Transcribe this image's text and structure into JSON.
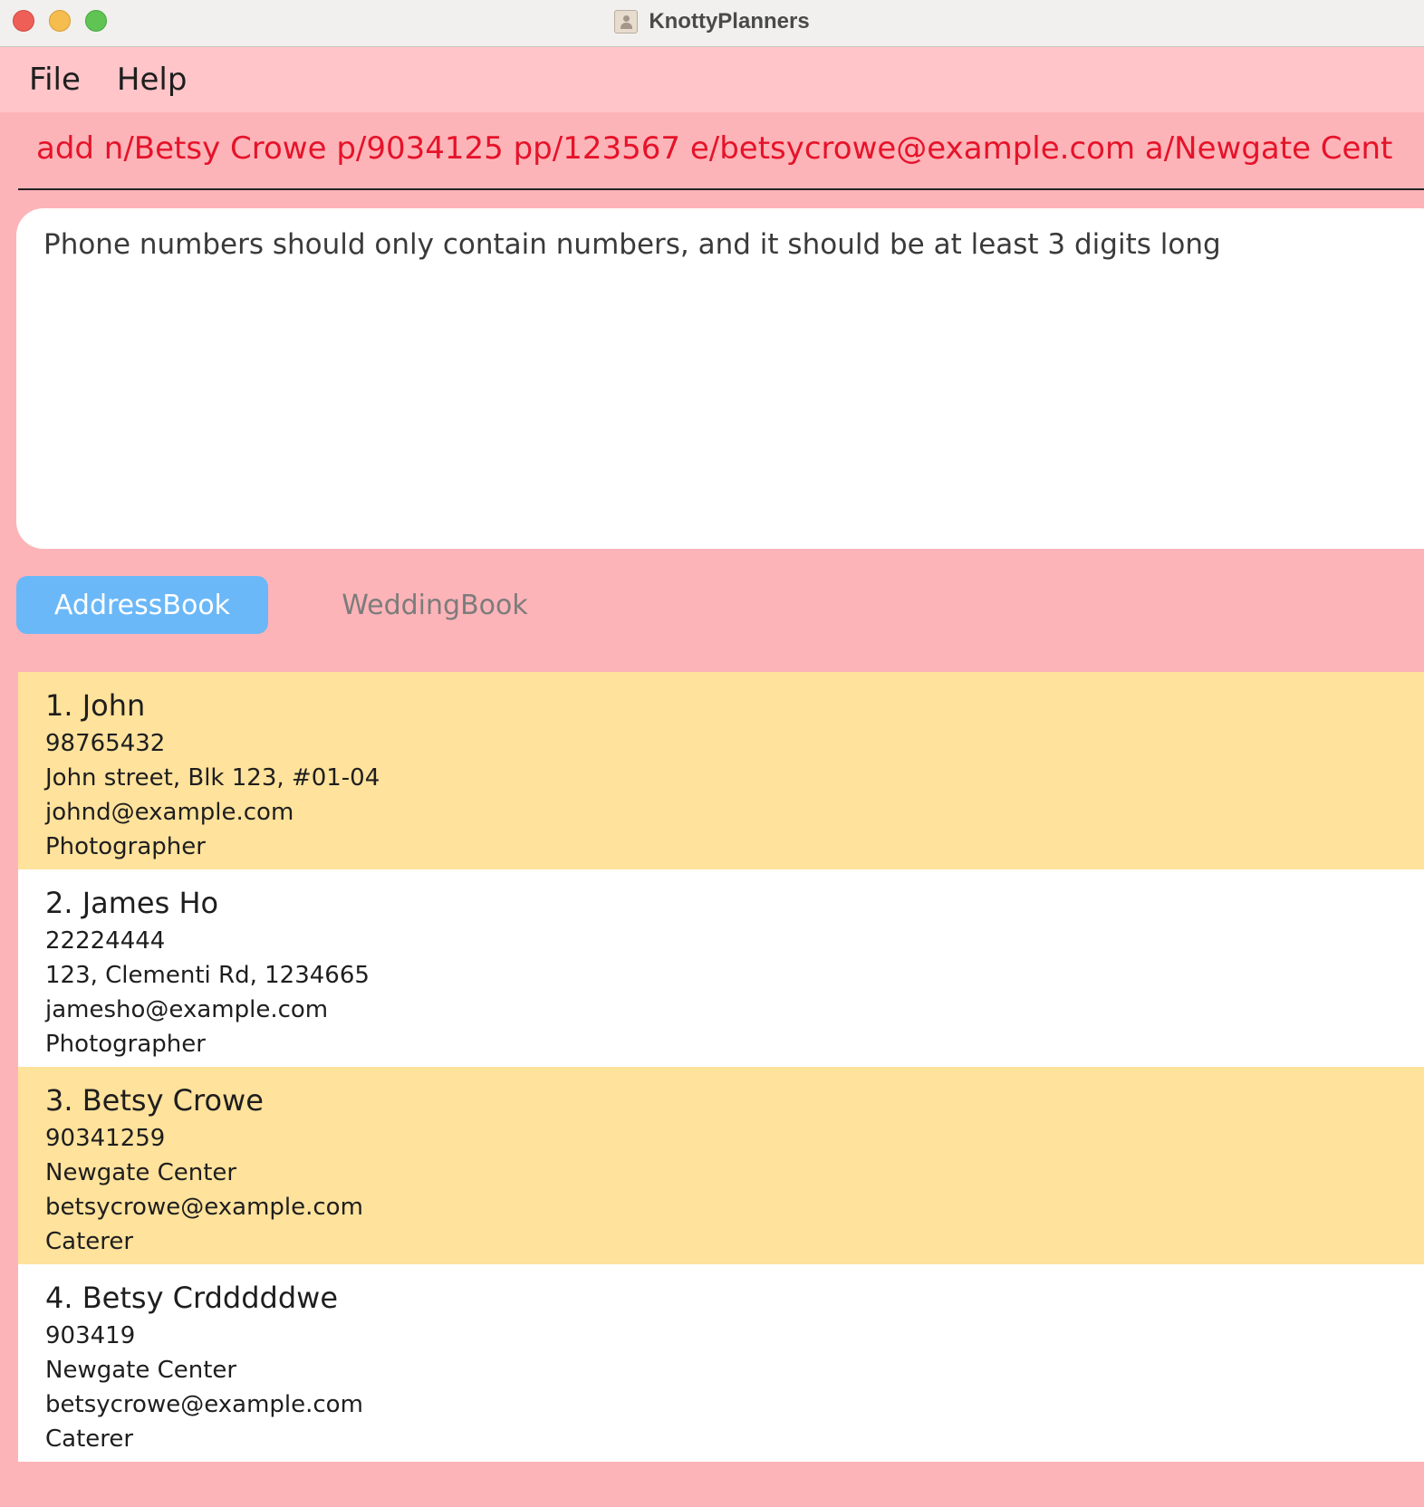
{
  "window": {
    "title": "KnottyPlanners"
  },
  "menu": {
    "file_label": "File",
    "help_label": "Help"
  },
  "command": {
    "value": "add n/Betsy Crowe p/9034125 pp/123567 e/betsycrowe@example.com a/Newgate Cent"
  },
  "result": {
    "message": "Phone numbers should only contain numbers, and it should be at least 3 digits long"
  },
  "tabs": [
    {
      "label": "AddressBook",
      "active": true
    },
    {
      "label": "WeddingBook",
      "active": false
    }
  ],
  "contacts": [
    {
      "index_name": "1. John",
      "phone": "98765432",
      "address": "John street, Blk 123, #01-04",
      "email": "johnd@example.com",
      "job": "Photographer"
    },
    {
      "index_name": "2. James Ho",
      "phone": "22224444",
      "address": "123, Clementi Rd, 1234665",
      "email": "jamesho@example.com",
      "job": "Photographer"
    },
    {
      "index_name": "3. Betsy Crowe",
      "phone": "90341259",
      "address": "Newgate Center",
      "email": "betsycrowe@example.com",
      "job": "Caterer"
    },
    {
      "index_name": "4. Betsy Crdddddwe",
      "phone": "903419",
      "address": "Newgate Center",
      "email": "betsycrowe@example.com",
      "job": "Caterer"
    }
  ],
  "colors": {
    "background": "#FDB4B8",
    "menu_background": "#FFC5C8",
    "command_text": "#E5132A",
    "active_tab": "#6BB8F8",
    "card_highlight": "#FFE29C",
    "card_plain": "#FFFFFF"
  },
  "icons": {
    "close": "close-traffic-light",
    "minimize": "minimize-traffic-light",
    "maximize": "maximize-traffic-light",
    "app": "address-book-app-icon"
  }
}
